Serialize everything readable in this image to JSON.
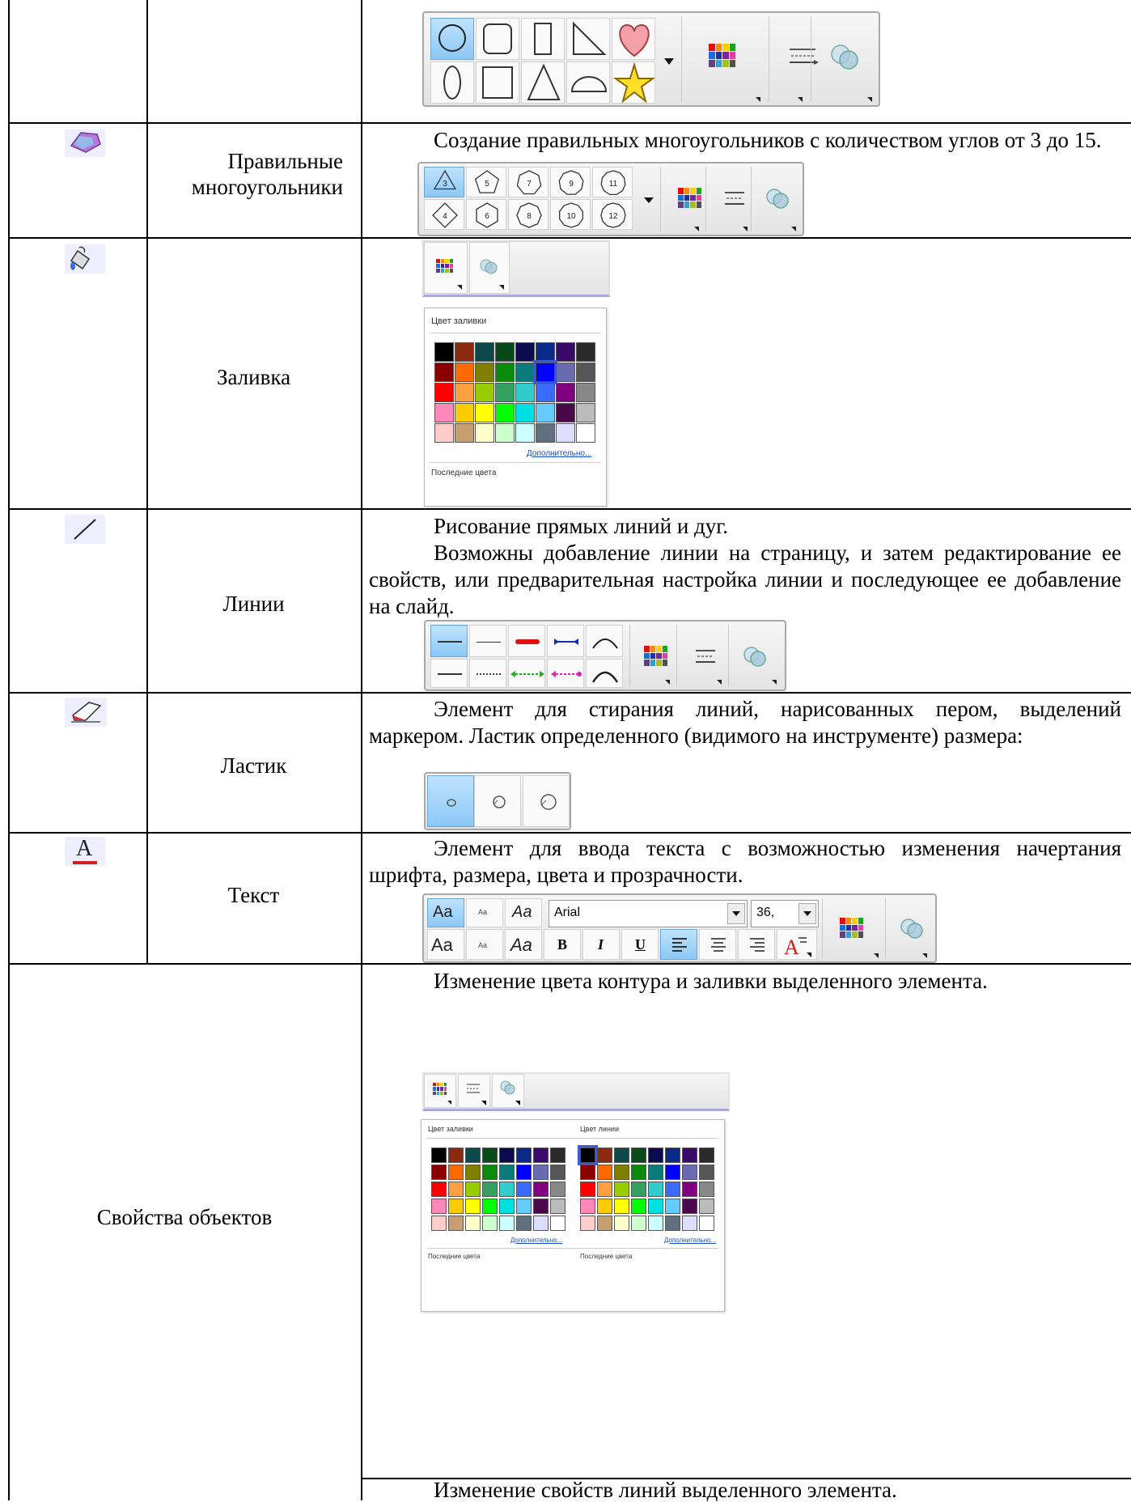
{
  "rows": [
    {
      "name": "",
      "icon": "shapes-icon"
    },
    {
      "name": "Правильные многоугольники",
      "icon": "polygon-icon",
      "desc": [
        "Создание правильных многоугольников с количеством углов  от 3 до 15."
      ],
      "polygons_top": [
        "3",
        "5",
        "7",
        "9",
        "11"
      ],
      "polygons_bottom": [
        "4",
        "6",
        "8",
        "10",
        "12"
      ]
    },
    {
      "name": "Заливка",
      "icon": "paint-bucket-icon",
      "panel_title": "Цвет заливки",
      "more": "Дополнительно...",
      "recent": "Последние цвета"
    },
    {
      "name": "Линии",
      "icon": "line-icon",
      "desc": [
        "Рисование прямых линий и дуг.",
        "Возможны добавление линии на страницу, и затем редактирование ее свойств, или предварительная настройка линии и последующее ее добавление на слайд."
      ]
    },
    {
      "name": "Ластик",
      "icon": "eraser-icon",
      "desc": [
        "Элемент для стирания линий, нарисованных пером, выделений маркером. Ластик определенного (видимого на инструменте) размера:"
      ]
    },
    {
      "name": "Текст",
      "icon": "text-icon",
      "desc": [
        "Элемент для ввода текста с возможностью изменения начертания шрифта, размера, цвета и прозрачности."
      ],
      "font": "Arial",
      "size": "36,",
      "bold": "B",
      "italic": "I",
      "underline": "U",
      "aa": "Aa"
    },
    {
      "name": "Свойства объектов",
      "desc": [
        "Изменение цвета контура и заливки выделенного элемента."
      ],
      "fill_title": "Цвет заливки",
      "line_title": "Цвет линии",
      "more": "Дополнительно...",
      "recent": "Последние цвета",
      "desc2": "Изменение свойств линий выделенного элемента."
    }
  ],
  "colors": {
    "palette": [
      [
        "#000000",
        "#8b2a0e",
        "#0c4a4a",
        "#0a4a1a",
        "#0b0b4f",
        "#0a2a8a",
        "#3a0a6a",
        "#2a2a2a"
      ],
      [
        "#8a0000",
        "#ff6a00",
        "#808000",
        "#0a8a0a",
        "#0a7a7a",
        "#0000ff",
        "#6a6ab0",
        "#555555"
      ],
      [
        "#ff0000",
        "#ffa040",
        "#99cc00",
        "#33a060",
        "#33cccc",
        "#3a6aff",
        "#800080",
        "#888888"
      ],
      [
        "#ff88bb",
        "#ffcc00",
        "#ffff00",
        "#00ff00",
        "#00e0e0",
        "#66ccff",
        "#4a0a4a",
        "#bbbbbb"
      ],
      [
        "#ffcccc",
        "#c8a070",
        "#ffffcc",
        "#ccffcc",
        "#ccffff",
        "#607080",
        "#ddddff",
        "#ffffff"
      ]
    ],
    "selected": "#0000ff"
  }
}
